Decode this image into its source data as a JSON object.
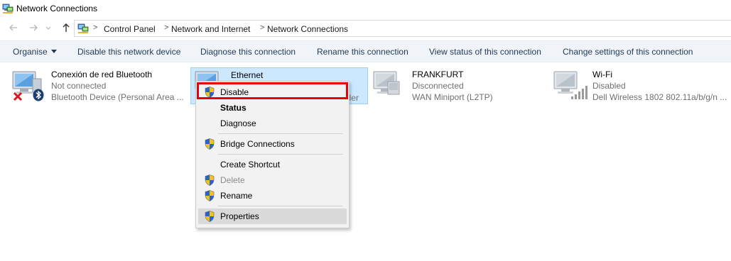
{
  "window": {
    "title": "Network Connections"
  },
  "navigation": {
    "back_icon": "arrow-left-icon",
    "forward_icon": "arrow-right-icon",
    "history_icon": "chevron-down-icon",
    "up_icon": "arrow-up-icon",
    "breadcrumbs": [
      "Control Panel",
      "Network and Internet",
      "Network Connections"
    ],
    "separator": ">"
  },
  "command_bar": {
    "organise": "Organise",
    "disable_device": "Disable this network device",
    "diagnose": "Diagnose this connection",
    "rename": "Rename this connection",
    "view_status": "View status of this connection",
    "change_settings": "Change settings of this connection"
  },
  "connections": [
    {
      "name": "Conexión de red Bluetooth",
      "status": "Not connected",
      "device": "Bluetooth Device (Personal Area ...",
      "badge": "red-x-icon",
      "extra_badge": "bluetooth-icon"
    },
    {
      "name": "Ethernet",
      "status": "",
      "device": "ller",
      "badge": "",
      "selected": true
    },
    {
      "name": "FRANKFURT",
      "status": "Disconnected",
      "device": "WAN Miniport (L2TP)",
      "badge": ""
    },
    {
      "name": "Wi-Fi",
      "status": "Disabled",
      "device": "Dell Wireless 1802 802.11a/b/g/n ...",
      "badge": "signal-bars-icon"
    }
  ],
  "context_menu": {
    "items": [
      {
        "label": "Disable",
        "shield": true,
        "style": "normal"
      },
      {
        "label": "Status",
        "shield": false,
        "style": "bold"
      },
      {
        "label": "Diagnose",
        "shield": false,
        "style": "normal"
      },
      {
        "label": "Bridge Connections",
        "shield": true,
        "style": "normal"
      },
      {
        "label": "Create Shortcut",
        "shield": false,
        "style": "normal"
      },
      {
        "label": "Delete",
        "shield": true,
        "style": "disabled"
      },
      {
        "label": "Rename",
        "shield": true,
        "style": "normal"
      },
      {
        "label": "Properties",
        "shield": true,
        "style": "hover"
      }
    ]
  },
  "colors": {
    "selection_bg": "#cce8ff",
    "highlight_outline": "#e8000b",
    "command_bar_bg": "#f0f4f9",
    "menu_bg": "#f2f2f2"
  }
}
